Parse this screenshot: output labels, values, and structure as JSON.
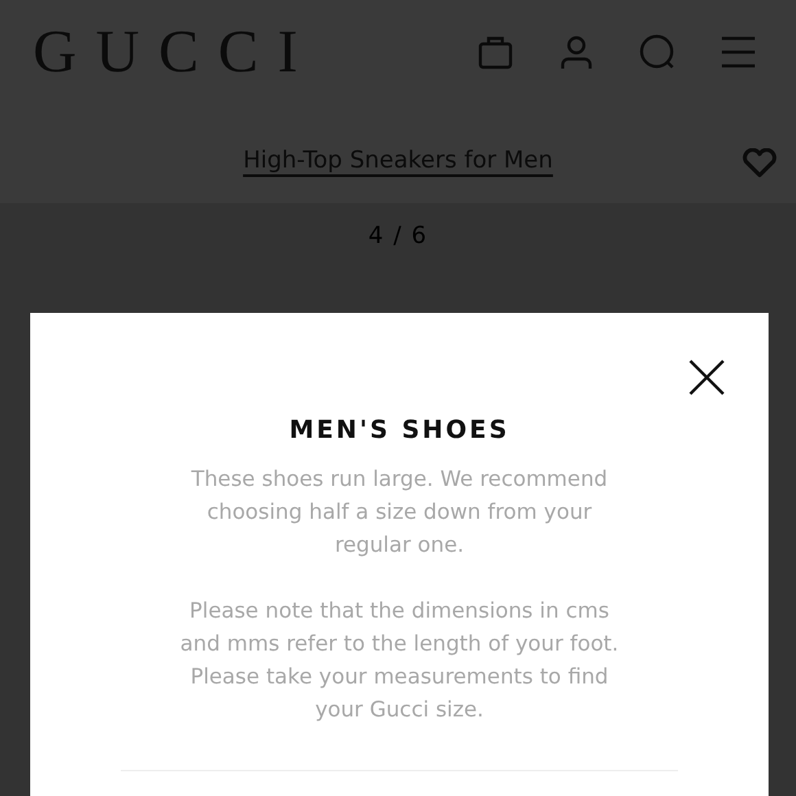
{
  "header": {
    "logo": "GUCCI"
  },
  "product": {
    "title": "High-Top Sneakers for Men"
  },
  "gallery": {
    "counter": "4 / 6"
  },
  "modal": {
    "title": "MEN'S SHOES",
    "paragraphs": [
      "These shoes run large. We recommend choosing half a size down from your regular one.",
      "Please note that the dimensions in cms and mms refer to the length of your foot. Please take your measurements to find your Gucci size."
    ]
  }
}
